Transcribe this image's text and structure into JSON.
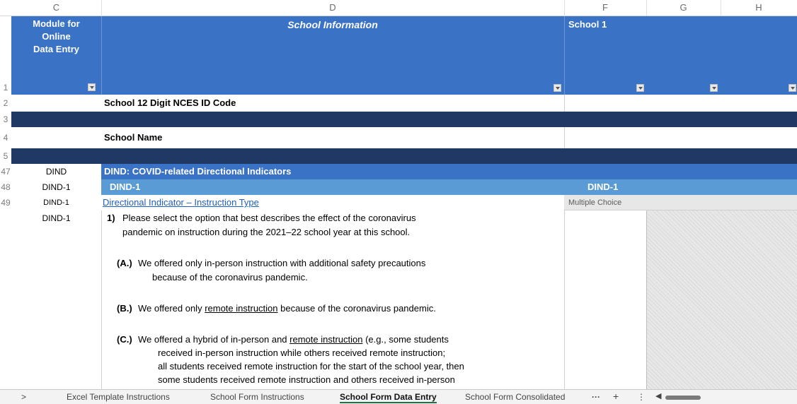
{
  "columns": {
    "c": "C",
    "d": "D",
    "f": "F",
    "g": "G",
    "h": "H"
  },
  "rows": [
    "1",
    "2",
    "3",
    "4",
    "5",
    "47",
    "48",
    "49"
  ],
  "header": {
    "module_label": "Module for\nOnline\nData Entry",
    "school_info_label": "School Information",
    "school1_label": "School 1"
  },
  "row2": {
    "label": "School 12 Digit NCES ID Code"
  },
  "row4": {
    "label": "School Name"
  },
  "row47": {
    "code": "DIND",
    "label": "DIND: COVID-related Directional Indicators"
  },
  "row48": {
    "code": "DIND-1",
    "label": "DIND-1",
    "school_label": "DIND-1"
  },
  "row49": {
    "code": "DIND-1",
    "link": "Directional Indicator – Instruction Type",
    "response_type": "Multiple Choice"
  },
  "question": {
    "code": "DIND-1",
    "number": "1)",
    "text_line1": "Please select the option that best describes the effect of the coronavirus",
    "text_line2": "pandemic on instruction during the 2021–22 school year at this school.",
    "optA_label": "(A.)",
    "optA_line1": "We offered only in-person instruction with additional safety precautions",
    "optA_line2": "because of the coronavirus pandemic.",
    "optB_label": "(B.)",
    "optB_pre": "We offered only ",
    "optB_link": "remote instruction",
    "optB_post": " because of the coronavirus pandemic.",
    "optC_label": "(C.)",
    "optC_pre": "We offered a hybrid of in-person and ",
    "optC_link": "remote instruction",
    "optC_post": " (e.g., some students",
    "optC_line2": "received in-person instruction while others received remote instruction;",
    "optC_line3": "all students received remote instruction for the start of the school year, then",
    "optC_line4": "some students received remote instruction and others received in-person"
  },
  "tabs": {
    "nav_prev": ">",
    "t1": "Excel Template Instructions",
    "t2": "School Form Instructions",
    "t3": "School Form Data Entry",
    "t4": "School Form Consolidated",
    "more": "···",
    "add": "+",
    "options": "⋮"
  },
  "colors": {
    "header_blue": "#3a72c6",
    "dark_band": "#1f3864",
    "light_blue": "#5b9bd5",
    "active_tab_underline": "#1e7145"
  }
}
